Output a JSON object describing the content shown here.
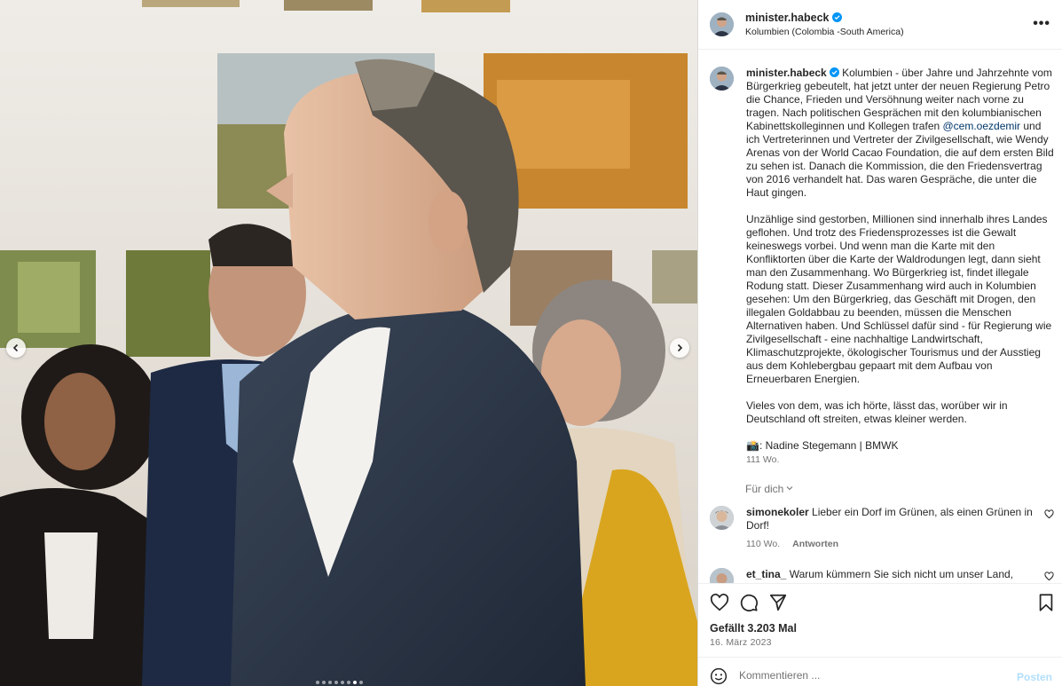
{
  "post": {
    "username": "minister.habeck",
    "location": "Kolumbien (Colombia -South America)",
    "more_label": "•••",
    "verified_icon": "verified-badge-icon"
  },
  "caption": {
    "username": "minister.habeck",
    "text_1": "Kolumbien - über Jahre und Jahrzehnte vom Bürgerkrieg gebeutelt, hat jetzt unter der neuen Regierung Petro die Chance, Frieden und Versöhnung weiter nach vorne zu tragen. Nach politischen Gesprächen mit den kolumbianischen Kabinettskolleginnen und Kollegen trafen ",
    "mention": "@cem.oezdemir",
    "text_2": " und ich Vertreterinnen und Vertreter der Zivilgesellschaft, wie Wendy Arenas von der World Cacao Foundation, die auf dem ersten Bild zu sehen ist. Danach die Kommission, die den Friedensvertrag von 2016 verhandelt hat. Das waren Gespräche, die unter die Haut gingen.\n\nUnzählige sind gestorben, Millionen sind innerhalb ihres Landes geflohen. Und trotz des Friedensprozesses ist die Gewalt keineswegs vorbei. Und wenn man die Karte mit den Konfliktorten über die Karte der Waldrodungen legt, dann sieht man den Zusammenhang. Wo Bürgerkrieg ist, findet illegale Rodung statt. Dieser Zusammenhang wird auch in Kolumbien gesehen: Um den Bürgerkrieg, das Geschäft mit Drogen, den illegalen Goldabbau zu beenden, müssen die Menschen Alternativen haben. Und Schlüssel dafür sind - für Regierung wie Zivilgesellschaft - eine nachhaltige Landwirtschaft, Klimaschutzprojekte, ökologischer Tourismus und der Ausstieg aus dem Kohlebergbau gepaart mit dem Aufbau von Erneuerbaren Energien.\n\nVieles von dem, was ich hörte, lässt das, worüber wir in Deutschland oft streiten, etwas kleiner werden.\n\n📸: Nadine Stegemann | BMWK",
    "time": "111 Wo.",
    "translate_label": "Für dich"
  },
  "comments": [
    {
      "username": "simonekoler",
      "text": "Lieber ein Dorf im Grünen, als einen Grünen in Dorf!",
      "time": "110 Wo.",
      "reply_label": "Antworten"
    },
    {
      "username": "et_tina_",
      "text": "Warum kümmern Sie sich nicht um unser Land,",
      "time": "",
      "reply_label": ""
    }
  ],
  "stats": {
    "likes": "Gefällt 3.203 Mal",
    "date": "16. März 2023"
  },
  "composer": {
    "placeholder": "Kommentieren ...",
    "post_label": "Posten"
  },
  "carousel": {
    "slide_count": 8,
    "active_slide": 6
  },
  "colors": {
    "accent_link": "#00376b",
    "verified": "#0095f6",
    "post_disabled": "#b2dffc",
    "muted": "#737373"
  },
  "icons": [
    "chevron-left-icon",
    "chevron-right-icon",
    "heart-icon",
    "comment-icon",
    "share-icon",
    "bookmark-icon",
    "emoji-icon",
    "more-icon",
    "chevron-down-icon"
  ]
}
